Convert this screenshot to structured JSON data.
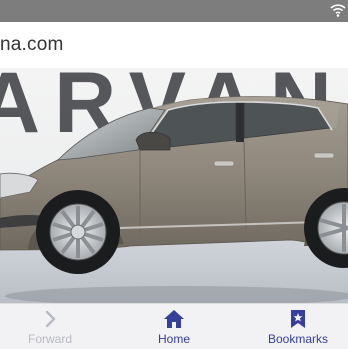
{
  "url_bar": {
    "url_text": "na.com"
  },
  "photo": {
    "backdrop_letters": "ARVAN"
  },
  "bottom_nav": {
    "items": [
      {
        "label": "Forward",
        "icon": "chevron-right-icon",
        "enabled": false
      },
      {
        "label": "Home",
        "icon": "home-icon",
        "enabled": true
      },
      {
        "label": "Bookmarks",
        "icon": "bookmark-star-icon",
        "enabled": true
      }
    ]
  },
  "colors": {
    "status_bar": "#7d7d7d",
    "nav_active": "#36409a",
    "nav_disabled": "#b8bac2",
    "car_body": "#8f877b"
  }
}
